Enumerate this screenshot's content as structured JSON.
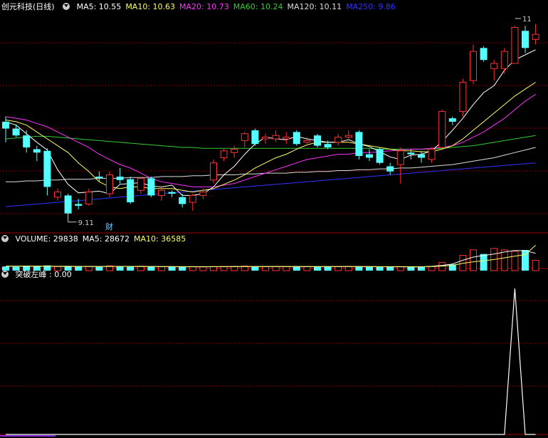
{
  "colors": {
    "up": "#ff3333",
    "down": "#54ffff",
    "grid": "#a00000",
    "ma5": "#ffffff",
    "ma10": "#ffff66",
    "ma20": "#ff33ff",
    "ma60": "#33cc33",
    "ma120": "#dddddd",
    "ma250": "#3333ff",
    "signal": "#ffffff",
    "cai": "#6cf"
  },
  "price_panel": {
    "stock": "创元科技",
    "period": "(日线)",
    "legend": [
      {
        "label": "MA5: 10.55",
        "color": "#ffffff"
      },
      {
        "label": "MA10: 10.63",
        "color": "#ffff66"
      },
      {
        "label": "MA20: 10.73",
        "color": "#ff33ff"
      },
      {
        "label": "MA60: 10.24",
        "color": "#33cc33"
      },
      {
        "label": "MA120: 10.11",
        "color": "#dddddd"
      },
      {
        "label": "MA250: 9.86",
        "color": "#3333ff"
      }
    ],
    "low_marker": "9.11",
    "high_marker": "11",
    "cai_label": "财"
  },
  "volume_panel": {
    "legend": [
      {
        "label": "VOLUME: 29838",
        "color": "#ffffff"
      },
      {
        "label": "MA5: 28672",
        "color": "#ffffff"
      },
      {
        "label": "MA10: 36585",
        "color": "#ffff66"
      }
    ]
  },
  "signal_panel": {
    "legend": [
      {
        "label": "突破左峰 : 0.00",
        "color": "#ffffff"
      }
    ]
  },
  "chart_data": {
    "type": "candlestick",
    "candles": [
      {
        "o": 10.28,
        "h": 10.34,
        "l": 10.04,
        "c": 10.2,
        "up": false
      },
      {
        "o": 10.2,
        "h": 10.25,
        "l": 10.1,
        "c": 10.12,
        "up": false
      },
      {
        "o": 10.12,
        "h": 10.18,
        "l": 9.92,
        "c": 9.98,
        "up": false
      },
      {
        "o": 9.96,
        "h": 10.0,
        "l": 9.82,
        "c": 9.92,
        "up": false
      },
      {
        "o": 9.94,
        "h": 9.97,
        "l": 9.42,
        "c": 9.52,
        "up": false
      },
      {
        "o": 9.4,
        "h": 9.5,
        "l": 9.36,
        "c": 9.46,
        "up": true
      },
      {
        "o": 9.42,
        "h": 9.44,
        "l": 9.11,
        "c": 9.21,
        "up": false
      },
      {
        "o": 9.32,
        "h": 9.38,
        "l": 9.26,
        "c": 9.3,
        "up": false
      },
      {
        "o": 9.32,
        "h": 9.5,
        "l": 9.3,
        "c": 9.46,
        "up": true
      },
      {
        "o": 9.64,
        "h": 9.7,
        "l": 9.58,
        "c": 9.62,
        "up": false
      },
      {
        "o": 9.44,
        "h": 9.7,
        "l": 9.4,
        "c": 9.66,
        "up": true
      },
      {
        "o": 9.64,
        "h": 9.74,
        "l": 9.56,
        "c": 9.6,
        "up": false
      },
      {
        "o": 9.61,
        "h": 9.64,
        "l": 9.32,
        "c": 9.34,
        "up": false
      },
      {
        "o": 9.48,
        "h": 9.64,
        "l": 9.44,
        "c": 9.62,
        "up": true
      },
      {
        "o": 9.62,
        "h": 9.64,
        "l": 9.4,
        "c": 9.42,
        "up": false
      },
      {
        "o": 9.42,
        "h": 9.52,
        "l": 9.36,
        "c": 9.48,
        "up": true
      },
      {
        "o": 9.46,
        "h": 9.48,
        "l": 9.4,
        "c": 9.44,
        "up": false
      },
      {
        "o": 9.4,
        "h": 9.44,
        "l": 9.28,
        "c": 9.32,
        "up": false
      },
      {
        "o": 9.34,
        "h": 9.44,
        "l": 9.24,
        "c": 9.42,
        "up": true
      },
      {
        "o": 9.42,
        "h": 9.5,
        "l": 9.38,
        "c": 9.46,
        "up": true
      },
      {
        "o": 9.6,
        "h": 9.84,
        "l": 9.56,
        "c": 9.8,
        "up": true
      },
      {
        "o": 9.86,
        "h": 9.96,
        "l": 9.82,
        "c": 9.94,
        "up": true
      },
      {
        "o": 9.92,
        "h": 10.0,
        "l": 9.86,
        "c": 9.96,
        "up": true
      },
      {
        "o": 10.06,
        "h": 10.16,
        "l": 9.98,
        "c": 10.14,
        "up": true
      },
      {
        "o": 10.18,
        "h": 10.2,
        "l": 10.0,
        "c": 10.02,
        "up": false
      },
      {
        "o": 10.08,
        "h": 10.14,
        "l": 10.02,
        "c": 10.1,
        "up": true
      },
      {
        "o": 10.08,
        "h": 10.18,
        "l": 10.04,
        "c": 10.12,
        "up": true
      },
      {
        "o": 10.08,
        "h": 10.16,
        "l": 10.02,
        "c": 10.1,
        "up": true
      },
      {
        "o": 10.16,
        "h": 10.18,
        "l": 10.0,
        "c": 10.02,
        "up": false
      },
      {
        "o": 10.04,
        "h": 10.1,
        "l": 10.0,
        "c": 10.06,
        "up": true
      },
      {
        "o": 10.12,
        "h": 10.14,
        "l": 9.98,
        "c": 10.0,
        "up": false
      },
      {
        "o": 10.02,
        "h": 10.06,
        "l": 9.96,
        "c": 9.98,
        "up": false
      },
      {
        "o": 10.04,
        "h": 10.14,
        "l": 10.0,
        "c": 10.1,
        "up": true
      },
      {
        "o": 10.1,
        "h": 10.18,
        "l": 10.06,
        "c": 10.12,
        "up": true
      },
      {
        "o": 10.16,
        "h": 10.18,
        "l": 9.84,
        "c": 9.88,
        "up": false
      },
      {
        "o": 9.9,
        "h": 9.96,
        "l": 9.82,
        "c": 9.86,
        "up": false
      },
      {
        "o": 9.96,
        "h": 9.98,
        "l": 9.78,
        "c": 9.8,
        "up": false
      },
      {
        "o": 9.76,
        "h": 9.8,
        "l": 9.66,
        "c": 9.7,
        "up": false
      },
      {
        "o": 9.78,
        "h": 9.98,
        "l": 9.56,
        "c": 9.94,
        "up": true
      },
      {
        "o": 9.92,
        "h": 9.96,
        "l": 9.84,
        "c": 9.9,
        "up": false
      },
      {
        "o": 9.9,
        "h": 9.94,
        "l": 9.8,
        "c": 9.86,
        "up": false
      },
      {
        "o": 9.84,
        "h": 9.98,
        "l": 9.8,
        "c": 9.96,
        "up": true
      },
      {
        "o": 9.98,
        "h": 10.42,
        "l": 9.98,
        "c": 10.4,
        "up": true
      },
      {
        "o": 10.32,
        "h": 10.34,
        "l": 10.24,
        "c": 10.28,
        "up": false
      },
      {
        "o": 10.4,
        "h": 10.78,
        "l": 10.34,
        "c": 10.74,
        "up": true
      },
      {
        "o": 10.76,
        "h": 11.18,
        "l": 10.72,
        "c": 11.1,
        "up": true
      },
      {
        "o": 11.14,
        "h": 11.16,
        "l": 10.98,
        "c": 11.0,
        "up": false
      },
      {
        "o": 10.9,
        "h": 11.0,
        "l": 10.76,
        "c": 10.96,
        "up": true
      },
      {
        "o": 10.9,
        "h": 11.14,
        "l": 10.84,
        "c": 11.1,
        "up": true
      },
      {
        "o": 10.96,
        "h": 11.4,
        "l": 10.96,
        "c": 11.38,
        "up": true
      },
      {
        "o": 11.34,
        "h": 11.4,
        "l": 11.08,
        "c": 11.14,
        "up": false
      },
      {
        "o": 11.3,
        "h": 11.42,
        "l": 11.18,
        "c": 11.24,
        "up": true
      }
    ],
    "ma5": [
      10.28,
      10.24,
      10.14,
      10.04,
      9.95,
      9.72,
      9.55,
      9.45,
      9.46,
      9.47,
      9.44,
      9.55,
      9.56,
      9.57,
      9.53,
      9.52,
      9.54,
      9.42,
      9.42,
      9.44,
      9.52,
      9.66,
      9.76,
      9.9,
      10.02,
      10.1,
      10.08,
      10.07,
      10.11,
      10.08,
      10.06,
      10.04,
      10.04,
      10.07,
      10.02,
      9.99,
      9.93,
      9.87,
      9.84,
      9.89,
      9.9,
      9.94,
      10.05,
      10.18,
      10.32,
      10.48,
      10.62,
      10.7,
      10.88,
      11.0,
      11.06,
      11.12
    ],
    "ma10": [
      10.3,
      10.28,
      10.24,
      10.16,
      10.08,
      10.0,
      9.92,
      9.8,
      9.7,
      9.58,
      9.52,
      9.5,
      9.52,
      9.52,
      9.5,
      9.5,
      9.5,
      9.48,
      9.46,
      9.48,
      9.5,
      9.55,
      9.6,
      9.66,
      9.74,
      9.8,
      9.86,
      9.9,
      9.96,
      10.01,
      10.04,
      10.04,
      10.04,
      10.04,
      10.02,
      10.0,
      9.98,
      9.96,
      9.94,
      9.94,
      9.93,
      9.93,
      9.96,
      10.0,
      10.08,
      10.18,
      10.28,
      10.38,
      10.48,
      10.58,
      10.66,
      10.74
    ],
    "ma20": [
      10.34,
      10.32,
      10.3,
      10.26,
      10.22,
      10.16,
      10.1,
      10.04,
      9.98,
      9.9,
      9.84,
      9.78,
      9.74,
      9.68,
      9.62,
      9.58,
      9.56,
      9.54,
      9.52,
      9.52,
      9.52,
      9.54,
      9.56,
      9.6,
      9.64,
      9.68,
      9.72,
      9.76,
      9.8,
      9.84,
      9.86,
      9.88,
      9.9,
      9.9,
      9.92,
      9.92,
      9.93,
      9.94,
      9.95,
      9.96,
      9.96,
      9.97,
      9.98,
      10.0,
      10.04,
      10.1,
      10.16,
      10.24,
      10.32,
      10.42,
      10.52,
      10.6
    ],
    "ma60": [
      10.08,
      10.09,
      10.1,
      10.11,
      10.11,
      10.1,
      10.09,
      10.08,
      10.07,
      10.06,
      10.05,
      10.04,
      10.03,
      10.02,
      10.01,
      10.0,
      9.99,
      9.98,
      9.98,
      9.97,
      9.97,
      9.97,
      9.97,
      9.97,
      9.97,
      9.97,
      9.97,
      9.97,
      9.97,
      9.97,
      9.97,
      9.97,
      9.97,
      9.97,
      9.97,
      9.97,
      9.96,
      9.96,
      9.96,
      9.96,
      9.96,
      9.96,
      9.97,
      9.98,
      9.99,
      10.0,
      10.02,
      10.04,
      10.06,
      10.08,
      10.1,
      10.12
    ],
    "ma120": [
      9.58,
      9.58,
      9.59,
      9.59,
      9.6,
      9.6,
      9.61,
      9.61,
      9.61,
      9.62,
      9.62,
      9.62,
      9.63,
      9.63,
      9.63,
      9.64,
      9.64,
      9.64,
      9.65,
      9.65,
      9.66,
      9.66,
      9.66,
      9.67,
      9.67,
      9.68,
      9.68,
      9.68,
      9.69,
      9.69,
      9.7,
      9.7,
      9.71,
      9.71,
      9.72,
      9.72,
      9.73,
      9.73,
      9.74,
      9.74,
      9.75,
      9.76,
      9.77,
      9.78,
      9.8,
      9.82,
      9.84,
      9.86,
      9.89,
      9.92,
      9.95,
      9.98
    ],
    "ma250": [
      9.29,
      9.3,
      9.31,
      9.32,
      9.33,
      9.34,
      9.35,
      9.36,
      9.37,
      9.38,
      9.39,
      9.4,
      9.41,
      9.42,
      9.43,
      9.44,
      9.45,
      9.46,
      9.47,
      9.48,
      9.49,
      9.5,
      9.51,
      9.52,
      9.53,
      9.54,
      9.55,
      9.56,
      9.57,
      9.58,
      9.59,
      9.6,
      9.61,
      9.62,
      9.63,
      9.64,
      9.65,
      9.66,
      9.67,
      9.68,
      9.69,
      9.7,
      9.71,
      9.72,
      9.73,
      9.74,
      9.75,
      9.76,
      9.77,
      9.78,
      9.79,
      9.8
    ],
    "price_ylim": [
      9.0,
      11.55
    ],
    "volume": [
      6000,
      5500,
      7000,
      6500,
      7500,
      6000,
      6800,
      5800,
      6200,
      5400,
      7000,
      6000,
      5600,
      6400,
      5800,
      5600,
      5400,
      5600,
      5800,
      5500,
      5800,
      6000,
      6200,
      6600,
      5800,
      5600,
      6000,
      5800,
      5600,
      6000,
      5800,
      5600,
      5800,
      6200,
      6000,
      5600,
      5400,
      5200,
      5800,
      5400,
      5600,
      6000,
      12000,
      9000,
      22000,
      30000,
      24000,
      32000,
      30000,
      28000,
      29838,
      15000
    ],
    "vol_ma5": [
      6300,
      6400,
      6500,
      6400,
      6200,
      6100,
      6000,
      6100,
      6000,
      6000,
      6100,
      6200,
      6100,
      6000,
      5900,
      5800,
      5700,
      5600,
      5600,
      5600,
      5700,
      5800,
      5900,
      6000,
      6000,
      5900,
      5900,
      5900,
      5900,
      5800,
      5800,
      5800,
      5900,
      5900,
      5900,
      5800,
      5700,
      5600,
      5600,
      5500,
      5500,
      6300,
      7600,
      9600,
      15000,
      19500,
      22000,
      24000,
      27000,
      29000,
      28672,
      25000
    ],
    "vol_ma10": [
      6500,
      6500,
      6500,
      6500,
      6400,
      6300,
      6300,
      6200,
      6200,
      6100,
      6100,
      6100,
      6100,
      6100,
      6000,
      5900,
      5900,
      5800,
      5800,
      5800,
      5800,
      5800,
      5800,
      5900,
      5900,
      5900,
      5900,
      5900,
      5900,
      5900,
      5900,
      5900,
      5900,
      5900,
      5900,
      5900,
      5800,
      5800,
      5800,
      5700,
      5700,
      6000,
      6600,
      7600,
      10500,
      12800,
      14300,
      16000,
      18500,
      21000,
      23000,
      36585
    ],
    "vol_ylim": [
      0,
      36000
    ],
    "signal": [
      0,
      0,
      0,
      0,
      0,
      0,
      0,
      0,
      0,
      0,
      0,
      0,
      0,
      0,
      0,
      0,
      0,
      0,
      0,
      0,
      0,
      0,
      0,
      0,
      0,
      0,
      0,
      0,
      0,
      0,
      0,
      0,
      0,
      0,
      0,
      0,
      0,
      0,
      0,
      0,
      0,
      0,
      0,
      0,
      0,
      0,
      0,
      0,
      0,
      1,
      0,
      0
    ],
    "signal_ylim": [
      0,
      1.05
    ]
  }
}
